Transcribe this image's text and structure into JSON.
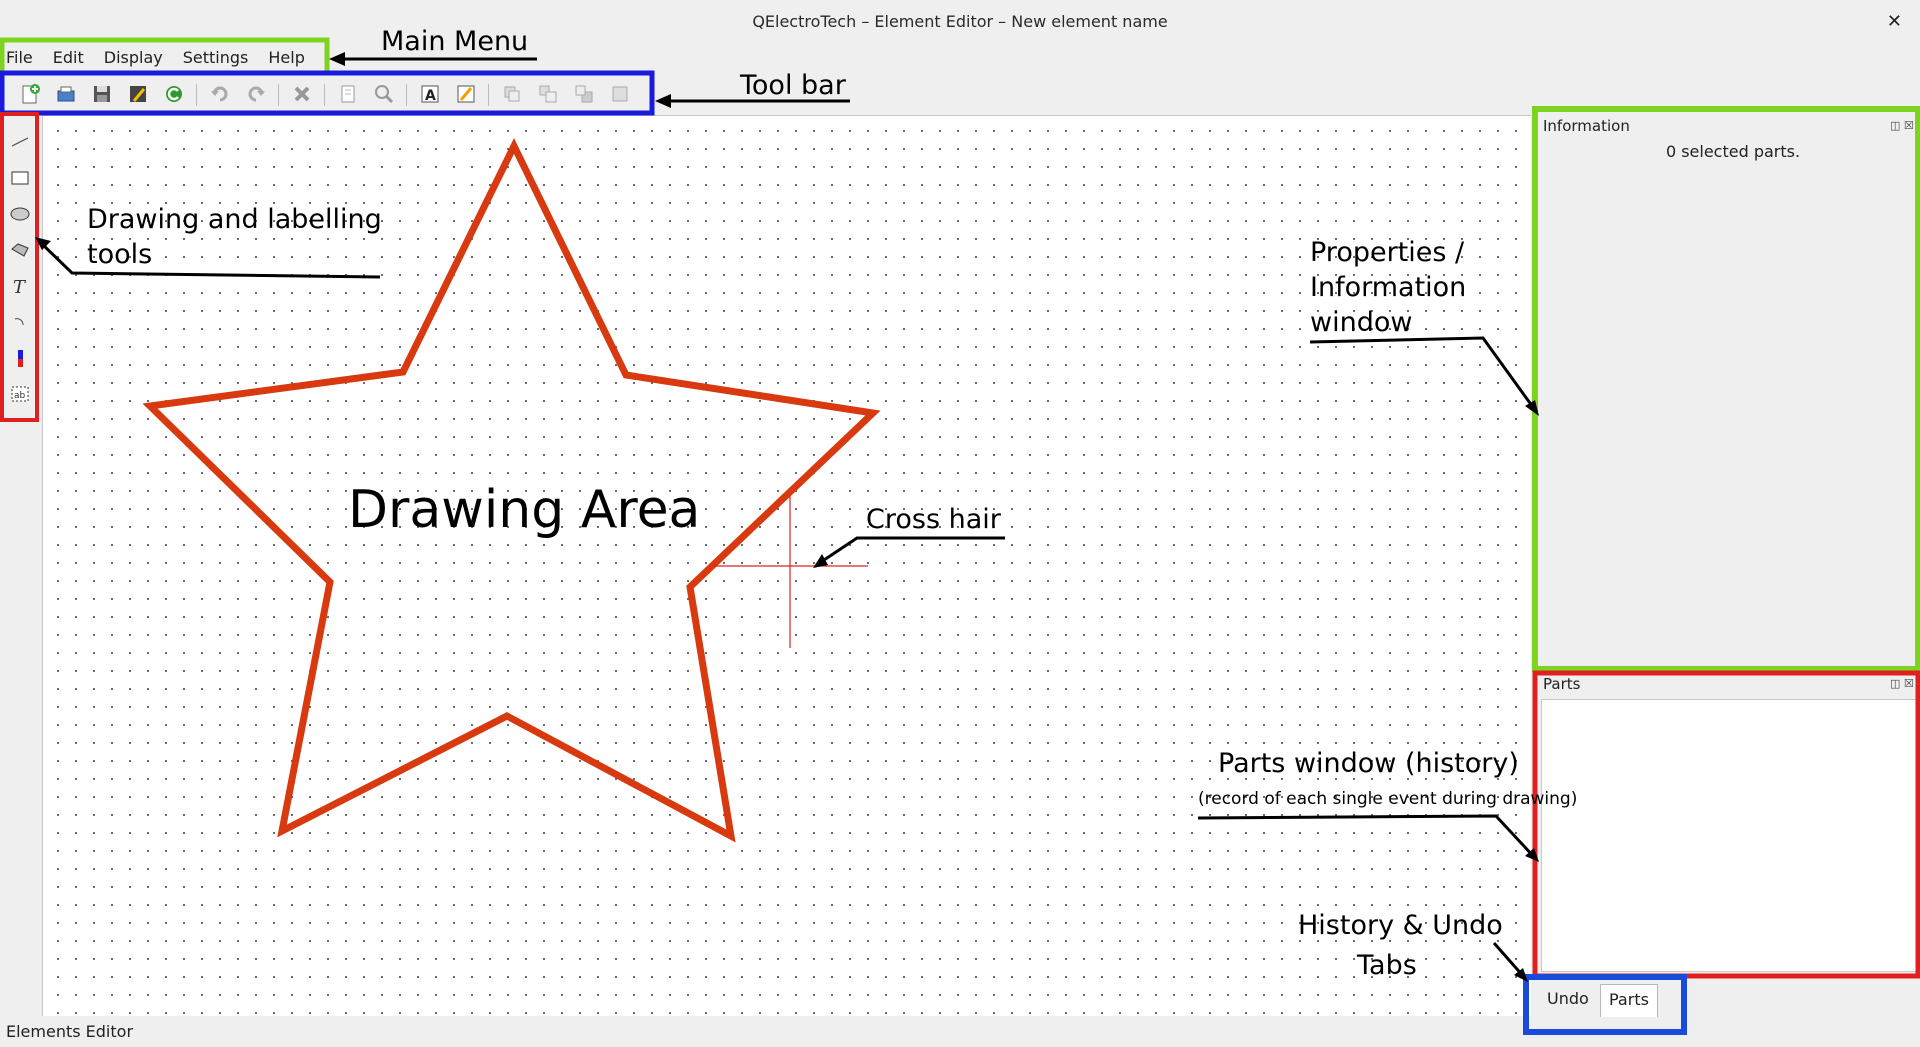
{
  "window": {
    "title": "QElectroTech – Element Editor – New element name",
    "close_glyph": "✕"
  },
  "menu": {
    "items": [
      "File",
      "Edit",
      "Display",
      "Settings",
      "Help"
    ]
  },
  "toolbar": {
    "icons": [
      "new-icon",
      "open-icon",
      "save-icon",
      "save-as-icon",
      "reload-icon",
      "undo-icon",
      "redo-icon",
      "delete-icon",
      "edit-size-icon",
      "zoom-fit-icon",
      "text-edit-icon",
      "edit-author-icon",
      "bring-forward-icon",
      "raise-icon",
      "lower-icon",
      "send-backward-icon"
    ]
  },
  "drawing_tools": {
    "icons": [
      "line-tool-icon",
      "rectangle-tool-icon",
      "ellipse-tool-icon",
      "polygon-tool-icon",
      "text-tool-icon",
      "arc-tool-icon",
      "terminal-tool-icon",
      "text-field-tool-icon"
    ]
  },
  "info_panel": {
    "title": "Information",
    "text": "0 selected parts."
  },
  "parts_panel": {
    "title": "Parts"
  },
  "tabs": {
    "undo": "Undo",
    "parts": "Parts"
  },
  "status": "Elements Editor",
  "annotations": {
    "main_menu": "Main Menu",
    "tool_bar": "Tool bar",
    "drawing_tools_1": "Drawing and labelling",
    "drawing_tools_2": "tools",
    "drawing_area": "Drawing Area",
    "cross_hair": "Cross hair",
    "properties_1": "Properties /",
    "properties_2": "Information",
    "properties_3": "window",
    "parts_window": "Parts window (history)",
    "parts_window_note": "(record of each single event during drawing)",
    "history_1": "History & Undo",
    "history_2": "Tabs"
  },
  "colors": {
    "green": "#7ed321",
    "blue": "#1a1adc",
    "red": "#e02020",
    "star": "#d9390f"
  }
}
